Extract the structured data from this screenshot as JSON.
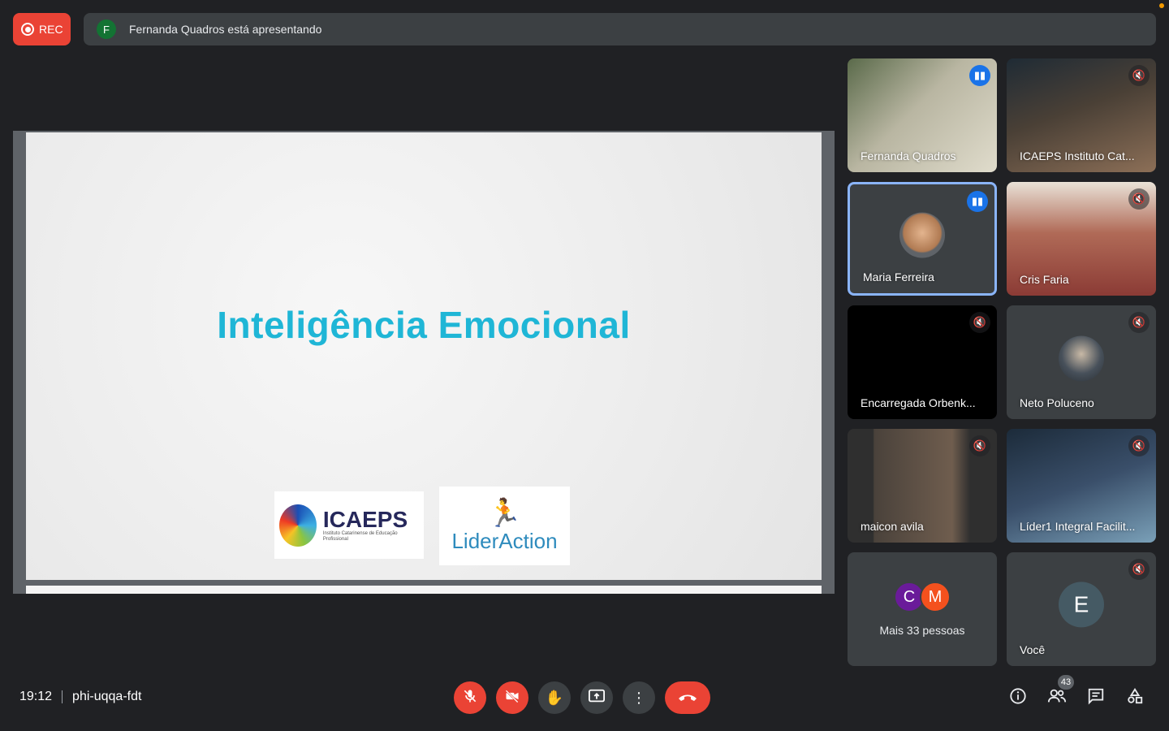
{
  "top_bar": {
    "rec_label": "REC",
    "presenter_initial": "F",
    "presenter_text": "Fernanda Quadros está apresentando"
  },
  "slide": {
    "title": "Inteligência Emocional",
    "logo_icaeps_name": "ICAEPS",
    "logo_icaeps_sub": "Instituto Catarinense de Educação Profissional",
    "logo_lider_name": "LiderAction"
  },
  "participants": [
    {
      "name": "Fernanda Quadros",
      "status": "speaking"
    },
    {
      "name": "ICAEPS Instituto Cat...",
      "status": "muted"
    },
    {
      "name": "Maria Ferreira",
      "status": "speaking"
    },
    {
      "name": "Cris Faria",
      "status": "muted"
    },
    {
      "name": "Encarregada Orbenk...",
      "status": "muted"
    },
    {
      "name": "Neto Poluceno",
      "status": "muted"
    },
    {
      "name": "maicon avila",
      "status": "muted"
    },
    {
      "name": "Líder1 Integral Facilit...",
      "status": "muted"
    }
  ],
  "more_people": {
    "label": "Mais 33 pessoas",
    "initial_1": "C",
    "initial_2": "M"
  },
  "self_tile": {
    "name": "Você",
    "initial": "E"
  },
  "bottom_bar": {
    "time": "19:12",
    "meeting_code": "phi-uqqa-fdt",
    "people_count": "43"
  },
  "colors": {
    "background": "#202124",
    "tile": "#3c4043",
    "danger": "#ea4335",
    "accent": "#1a73e8",
    "slide_title": "#1fb6d6"
  },
  "icons": {
    "mic": "mic-off-icon",
    "camera": "camera-off-icon",
    "hand": "raise-hand-icon",
    "present": "present-screen-icon",
    "more": "more-options-icon",
    "end": "end-call-icon",
    "info": "info-icon",
    "people": "people-icon",
    "chat": "chat-icon",
    "activities": "activities-icon"
  }
}
